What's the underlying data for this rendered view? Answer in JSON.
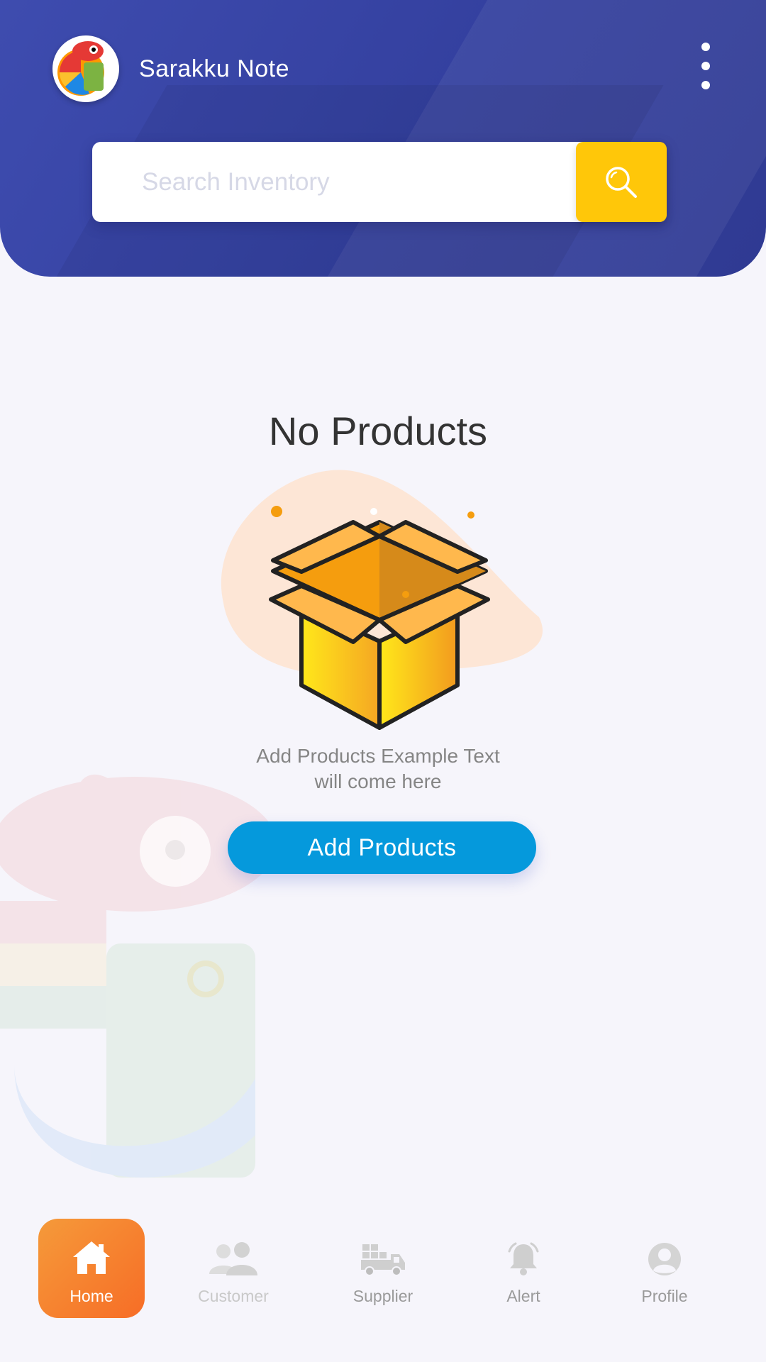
{
  "app": {
    "title": "Sarakku Note"
  },
  "search": {
    "placeholder": "Search Inventory"
  },
  "empty_state": {
    "title": "No Products",
    "description_line1": "Add Products Example Text",
    "description_line2": "will come here",
    "button_label": "Add Products"
  },
  "bottom_nav": {
    "items": [
      {
        "label": "Home",
        "icon": "home-icon",
        "active": true
      },
      {
        "label": "Customer",
        "icon": "customers-icon",
        "active": false
      },
      {
        "label": "Supplier",
        "icon": "truck-icon",
        "active": false
      },
      {
        "label": "Alert",
        "icon": "bell-icon",
        "active": false
      },
      {
        "label": "Profile",
        "icon": "profile-icon",
        "active": false
      }
    ]
  },
  "colors": {
    "header": "#3a47a8",
    "search_button": "#ffc709",
    "primary_button": "#0599dc",
    "nav_active": "#f7852f",
    "background": "#f6f5fb"
  }
}
